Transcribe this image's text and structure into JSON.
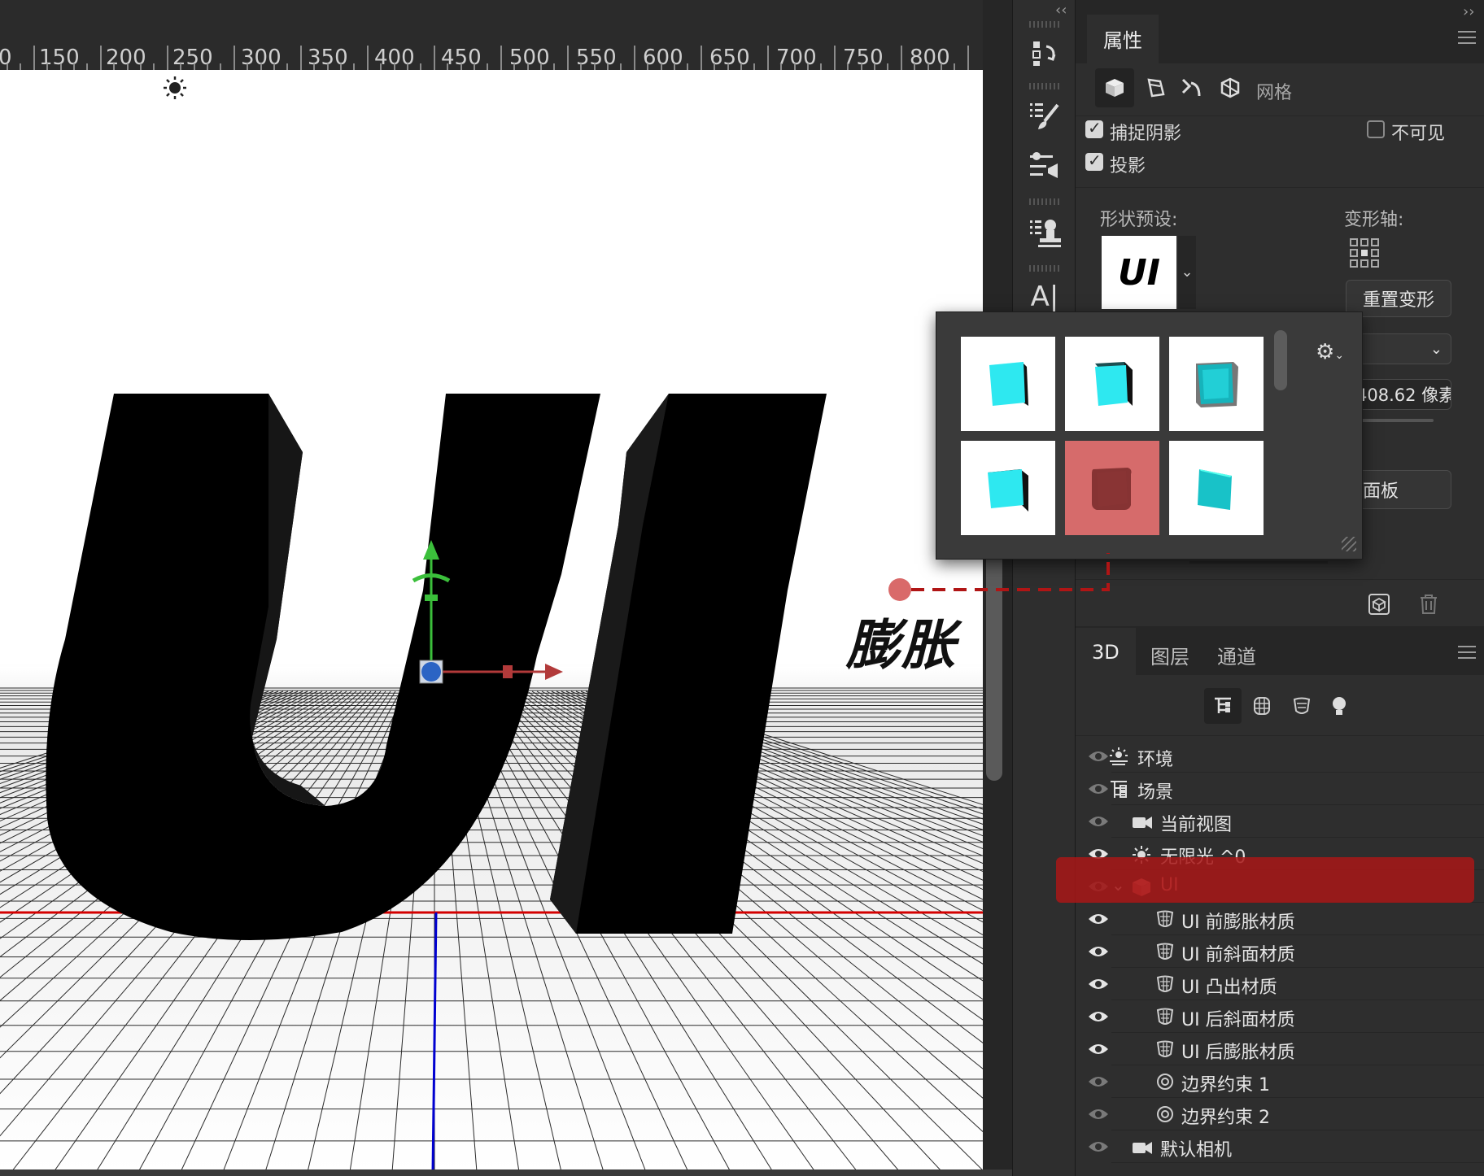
{
  "ruler": {
    "labels": [
      "0",
      "150",
      "200",
      "250",
      "300",
      "350",
      "400",
      "450",
      "500",
      "550",
      "600",
      "650",
      "700",
      "750",
      "800"
    ]
  },
  "canvas": {
    "model_text": "UI",
    "annotation": "膨胀",
    "colors": {
      "grid_red": "#d40000",
      "grid_blue": "#0000d0",
      "gizmo_green": "#3bbf3b",
      "gizmo_red": "#b23a3a",
      "gizmo_blue": "#2b64c4"
    }
  },
  "tools": [
    "history-panel-icon",
    "brush-settings-icon",
    "adjust-presets-icon",
    "clone-source-icon",
    "character-panel-icon"
  ],
  "properties": {
    "tab": "属性",
    "subtabs": {
      "mesh_label": "网格"
    },
    "capture_shadow": "捕捉阴影",
    "cast_shadow": "投影",
    "invisible": "不可见",
    "shape_preset_label": "形状预设:",
    "shape_preset_value": "UI",
    "deform_axis_label": "变形轴:",
    "reset_deform": "重置变形",
    "depth_value": "408.62 像素",
    "edit_button_partial": "背面板"
  },
  "popup": {
    "thumbs": [
      "cube",
      "cube-dark",
      "cube-bevel",
      "cube-extrude",
      "inflate",
      "cube-flat"
    ],
    "selected": 4
  },
  "layers_panel": {
    "tabs": [
      "3D",
      "图层",
      "通道"
    ],
    "rows": [
      {
        "label": "环境",
        "icon": "environment-icon",
        "indent": 0,
        "eye": "dim"
      },
      {
        "label": "场景",
        "icon": "scene-icon",
        "indent": 0,
        "eye": "dim"
      },
      {
        "label": "当前视图",
        "icon": "camera-icon",
        "indent": 1,
        "eye": "dim"
      },
      {
        "label": "无限光 ^0",
        "icon": "light-icon",
        "indent": 1,
        "eye": "on"
      },
      {
        "label": "UI",
        "icon": "mesh-icon",
        "indent": 1,
        "eye": "dim",
        "selected": true
      },
      {
        "label": "UI 前膨胀材质",
        "icon": "material-icon",
        "indent": 2,
        "eye": "on"
      },
      {
        "label": "UI 前斜面材质",
        "icon": "material-icon",
        "indent": 2,
        "eye": "on"
      },
      {
        "label": "UI 凸出材质",
        "icon": "material-icon",
        "indent": 2,
        "eye": "on"
      },
      {
        "label": "UI 后斜面材质",
        "icon": "material-icon",
        "indent": 2,
        "eye": "on"
      },
      {
        "label": "UI 后膨胀材质",
        "icon": "material-icon",
        "indent": 2,
        "eye": "on"
      },
      {
        "label": "边界约束 1",
        "icon": "constraint-icon",
        "indent": 2,
        "eye": "dim"
      },
      {
        "label": "边界约束 2",
        "icon": "constraint-icon",
        "indent": 2,
        "eye": "dim"
      },
      {
        "label": "默认相机",
        "icon": "camera-icon",
        "indent": 1,
        "eye": "dim"
      }
    ]
  }
}
